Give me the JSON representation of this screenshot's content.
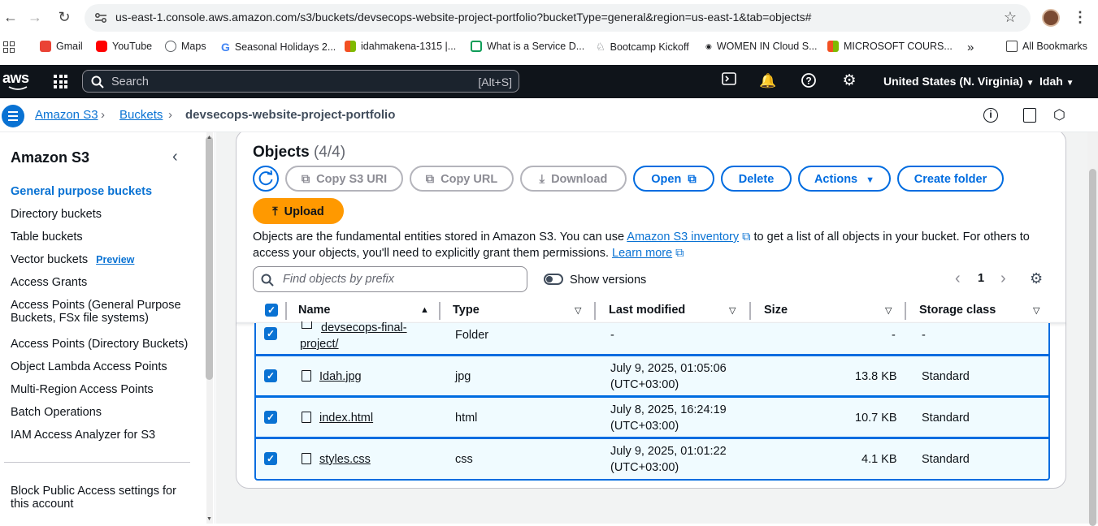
{
  "browser": {
    "url": "us-east-1.console.aws.amazon.com/s3/buckets/devsecops-website-project-portfolio?bucketType=general&region=us-east-1&tab=objects#",
    "bookmarks": [
      {
        "label": "Gmail",
        "color": "#ea4335"
      },
      {
        "label": "YouTube",
        "color": "#ff0000"
      },
      {
        "label": "Maps",
        "color": "#5f6368"
      },
      {
        "label": "Seasonal Holidays 2...",
        "color": "#4285f4"
      },
      {
        "label": "idahmakena-1315 |...",
        "color": "#f25022"
      },
      {
        "label": "What is a Service D...",
        "color": "#0f9d58"
      },
      {
        "label": "Bootcamp Kickoff",
        "color": "#5f6368"
      },
      {
        "label": "WOMEN IN Cloud S...",
        "color": "#202124"
      },
      {
        "label": "MICROSOFT COURS...",
        "color": "#f25022"
      }
    ],
    "all_bookmarks": "All Bookmarks"
  },
  "awsnav": {
    "logo": "aws",
    "search_placeholder": "Search",
    "search_shortcut": "[Alt+S]",
    "region": "United States (N. Virginia)",
    "user": "Idah"
  },
  "breadcrumb": {
    "items": [
      "Amazon S3",
      "Buckets",
      "devsecops-website-project-portfolio"
    ]
  },
  "sidebar": {
    "title": "Amazon S3",
    "items": [
      {
        "label": "General purpose buckets",
        "active": true
      },
      {
        "label": "Directory buckets"
      },
      {
        "label": "Table buckets"
      },
      {
        "label": "Vector buckets",
        "badge": "Preview"
      },
      {
        "label": "Access Grants"
      },
      {
        "label": "Access Points (General Purpose"
      },
      {
        "label": "Buckets, FSx file systems)"
      },
      {
        "label": "Access Points (Directory Buckets)"
      },
      {
        "label": "Object Lambda Access Points"
      },
      {
        "label": "Multi-Region Access Points"
      },
      {
        "label": "Batch Operations"
      },
      {
        "label": "IAM Access Analyzer for S3"
      }
    ],
    "footer_line1": "Block Public Access settings for",
    "footer_line2": "this account"
  },
  "objects": {
    "title": "Objects",
    "count": "(4/4)",
    "buttons": {
      "copy_s3_uri": "Copy S3 URI",
      "copy_url": "Copy URL",
      "download": "Download",
      "open": "Open",
      "delete": "Delete",
      "actions": "Actions",
      "create_folder": "Create folder",
      "upload": "Upload"
    },
    "description_part1": "Objects are the fundamental entities stored in Amazon S3. You can use ",
    "inventory_link": "Amazon S3 inventory",
    "description_part2": " to get a list of all objects in your bucket. For others to",
    "description_part3": "access your objects, you'll need to explicitly grant them permissions. ",
    "learn_more": "Learn more",
    "search_placeholder": "Find objects by prefix",
    "show_versions": "Show versions",
    "page_number": "1",
    "columns": [
      "Name",
      "Type",
      "Last modified",
      "Size",
      "Storage class"
    ],
    "rows": [
      {
        "name_line1": "devsecops-final-",
        "name_line2": "project/",
        "type": "Folder",
        "modified_line1": "-",
        "modified_line2": "",
        "size": "-",
        "storage": "-"
      },
      {
        "name_line1": "Idah.jpg",
        "name_line2": "",
        "type": "jpg",
        "modified_line1": "July 9, 2025, 01:05:06",
        "modified_line2": "(UTC+03:00)",
        "size": "13.8 KB",
        "storage": "Standard"
      },
      {
        "name_line1": "index.html",
        "name_line2": "",
        "type": "html",
        "modified_line1": "July 8, 2025, 16:24:19",
        "modified_line2": "(UTC+03:00)",
        "size": "10.7 KB",
        "storage": "Standard"
      },
      {
        "name_line1": "styles.css",
        "name_line2": "",
        "type": "css",
        "modified_line1": "July 9, 2025, 01:01:22",
        "modified_line2": "(UTC+03:00)",
        "size": "4.1 KB",
        "storage": "Standard"
      }
    ]
  }
}
